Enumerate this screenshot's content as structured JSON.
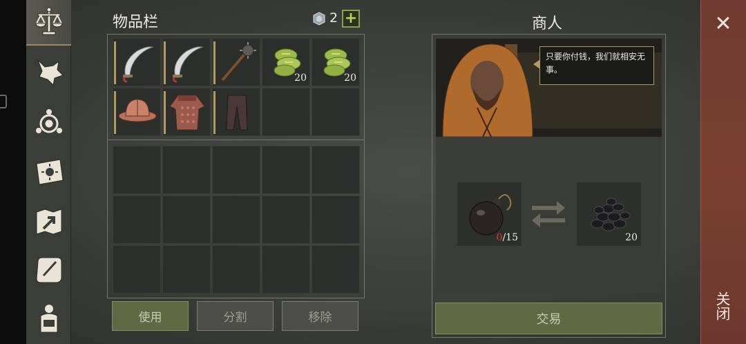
{
  "inventory": {
    "title": "物品栏",
    "gem_count": "2",
    "plus_label": "+",
    "equipped": [
      {
        "name": "scimitar-icon",
        "qty": ""
      },
      {
        "name": "scimitar-icon",
        "qty": ""
      },
      {
        "name": "spiked-mace-icon",
        "qty": ""
      },
      {
        "name": "cactus-icon",
        "qty": "20"
      },
      {
        "name": "cactus-icon",
        "qty": "20"
      },
      {
        "name": "kettle-helmet-icon",
        "qty": ""
      },
      {
        "name": "chainmail-shirt-icon",
        "qty": ""
      },
      {
        "name": "leather-pants-icon",
        "qty": ""
      },
      {
        "name": "",
        "qty": ""
      },
      {
        "name": "",
        "qty": ""
      }
    ],
    "buttons": {
      "use": "使用",
      "split": "分割",
      "remove": "移除"
    }
  },
  "merchant": {
    "title": "商人",
    "speech": "只要你付钱，我们就相安无事。",
    "give": {
      "icon": "bomb-icon",
      "have": "0",
      "need_total": "/15"
    },
    "receive": {
      "icon": "coal-pile-icon",
      "qty": "20"
    },
    "trade_label": "交易"
  },
  "close": {
    "icon": "close-icon",
    "label": "关闭"
  },
  "colors": {
    "accent_green": "#5f6a45",
    "close_red": "#7a3f32",
    "gold_border": "#b49a61",
    "need_red": "#d63a2a"
  }
}
